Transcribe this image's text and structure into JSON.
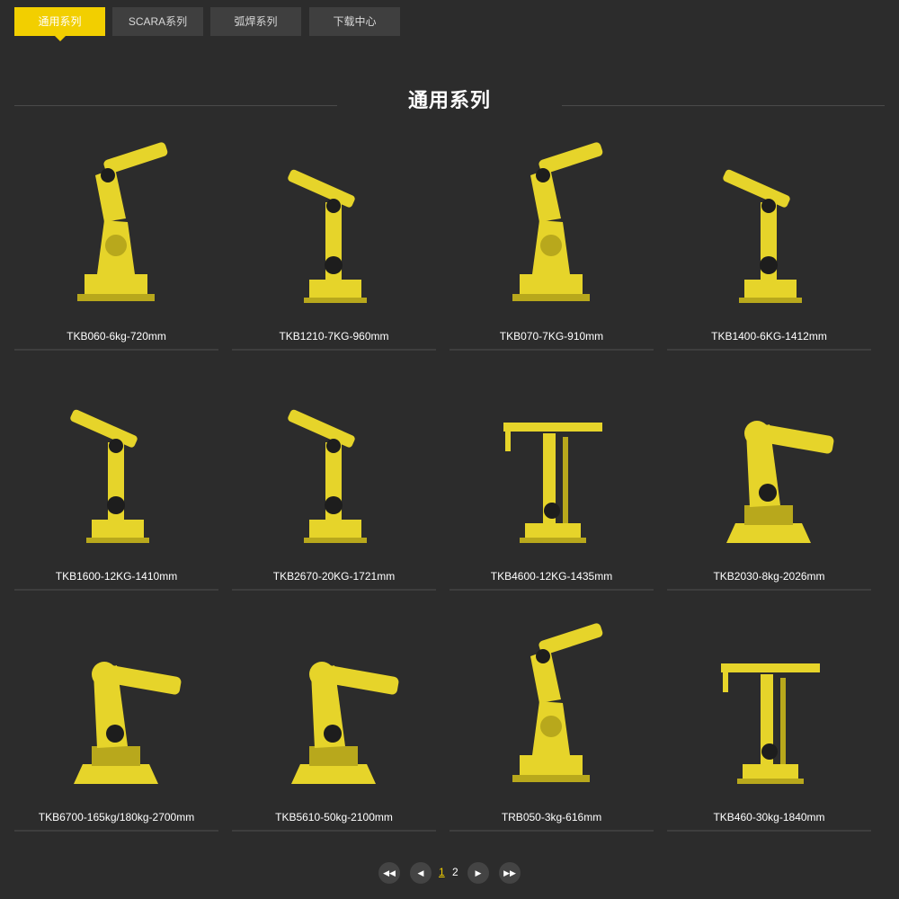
{
  "tabs": [
    {
      "label": "通用系列"
    },
    {
      "label": "SCARA系列"
    },
    {
      "label": "弧焊系列"
    },
    {
      "label": "下载中心"
    }
  ],
  "section_title": "通用系列",
  "colors": {
    "accent": "#f2cf00",
    "background": "#2c2c2c",
    "tab_bg": "#3f3f3f",
    "robot_yellow": "#e6d42a"
  },
  "products": [
    {
      "name": "TKB060-6kg-720mm",
      "image_icon": "robot-arm-icon"
    },
    {
      "name": "TKB1210-7KG-960mm",
      "image_icon": "robot-arm-icon"
    },
    {
      "name": "TKB070-7KG-910mm",
      "image_icon": "robot-arm-icon"
    },
    {
      "name": "TKB1400-6KG-1412mm",
      "image_icon": "robot-arm-icon"
    },
    {
      "name": "TKB1600-12KG-1410mm",
      "image_icon": "robot-arm-icon"
    },
    {
      "name": "TKB2670-20KG-1721mm",
      "image_icon": "robot-arm-icon"
    },
    {
      "name": "TKB4600-12KG-1435mm",
      "image_icon": "robot-arm-icon"
    },
    {
      "name": "TKB2030-8kg-2026mm",
      "image_icon": "robot-arm-icon"
    },
    {
      "name": "TKB6700-165kg/180kg-2700mm",
      "image_icon": "robot-arm-icon"
    },
    {
      "name": "TKB5610-50kg-2100mm",
      "image_icon": "robot-arm-icon"
    },
    {
      "name": "TRB050-3kg-616mm",
      "image_icon": "robot-arm-icon"
    },
    {
      "name": "TKB460-30kg-1840mm",
      "image_icon": "robot-arm-icon"
    }
  ],
  "pagination": {
    "first_icon": "first-page-icon",
    "prev_icon": "prev-page-icon",
    "pages": [
      "1",
      "2"
    ],
    "current": "1",
    "next_icon": "next-page-icon",
    "last_icon": "last-page-icon"
  }
}
